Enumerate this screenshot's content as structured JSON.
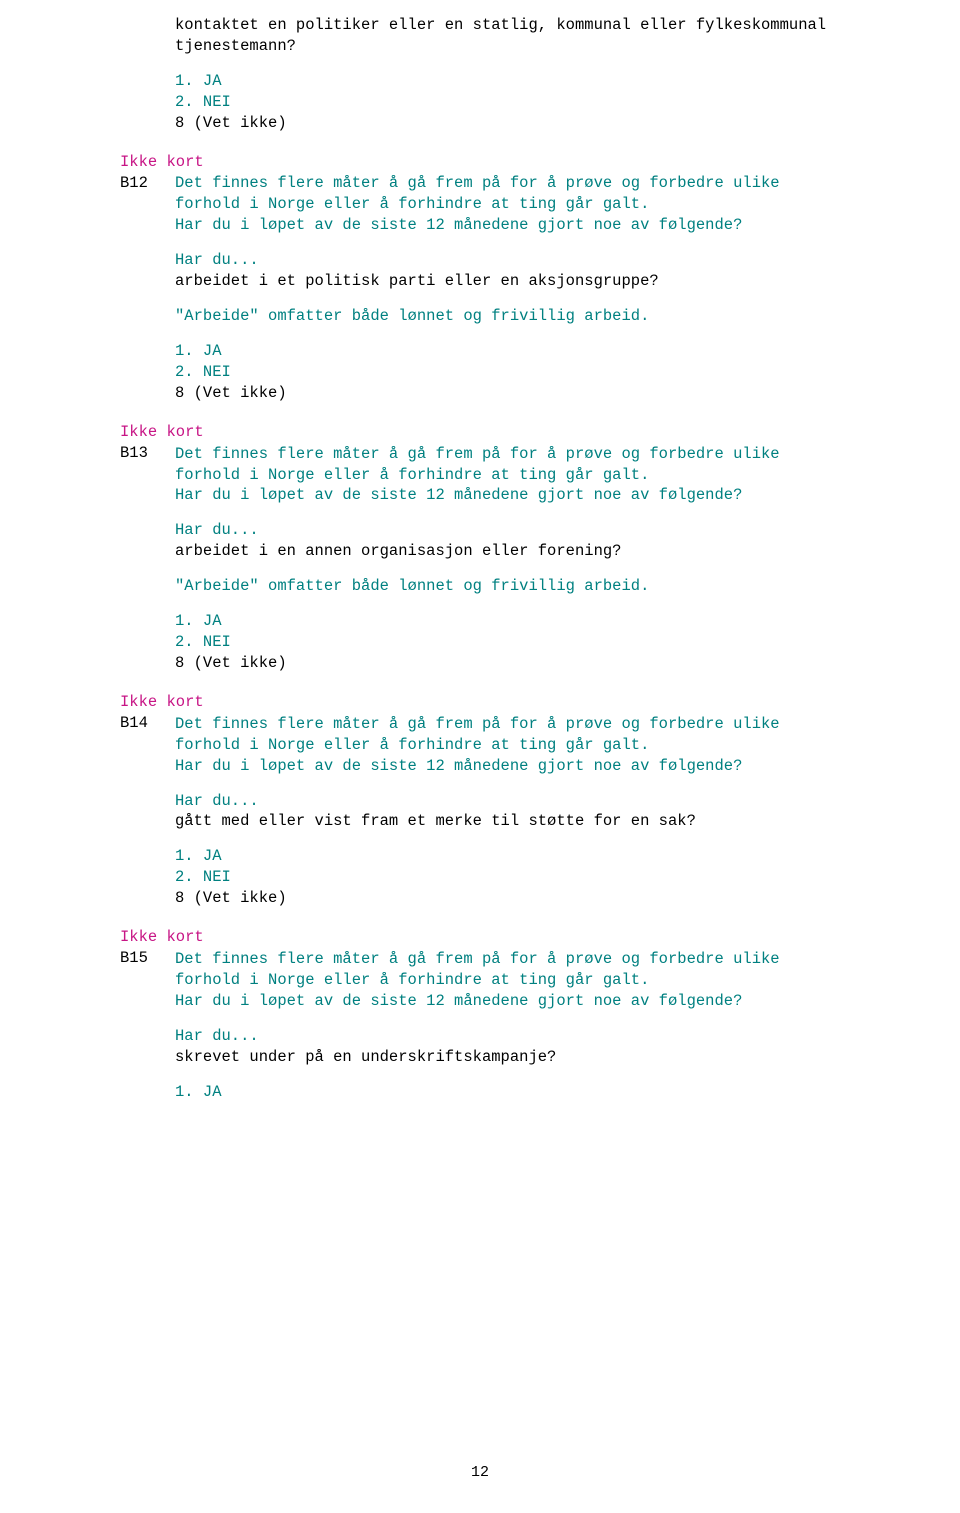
{
  "pagenum": "12",
  "ikke_kort": "Ikke kort",
  "intro_line1": "Det finnes flere måter å gå frem på for å prøve og forbedre ulike",
  "intro_line2": "forhold i Norge eller å forhindre at ting går galt.",
  "intro_line3": "Har du i løpet av de siste 12 månedene gjort noe av følgende?",
  "hardu": "Har du...",
  "arbeide_note": "\"Arbeide\" omfatter både lønnet og frivillig arbeid.",
  "opt1": "1. JA",
  "opt2": "2. NEI",
  "opt8": "8 (Vet ikke)",
  "b11": {
    "q_line1": "kontaktet en politiker eller en statlig, kommunal eller fylkeskommunal",
    "q_line2": "tjenestemann?"
  },
  "b12": {
    "id": "B12",
    "stem": "arbeidet i et politisk parti eller en aksjonsgruppe?"
  },
  "b13": {
    "id": "B13",
    "stem": "arbeidet i en annen organisasjon eller forening?"
  },
  "b14": {
    "id": "B14",
    "stem": "gått med eller vist fram et merke til støtte for en sak?"
  },
  "b15": {
    "id": "B15",
    "stem": "skrevet under på en underskriftskampanje?"
  }
}
